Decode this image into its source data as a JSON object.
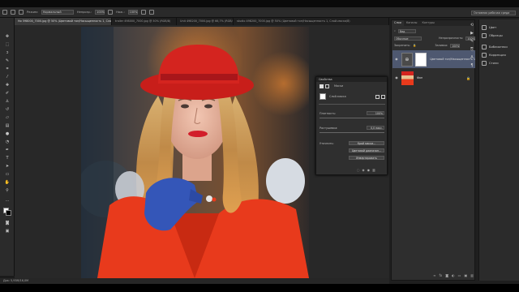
{
  "options_bar": {
    "mode_label": "Режим:",
    "mode_value": "Нормальный",
    "opacity_label": "Непрозр.:",
    "opacity_value": "100%",
    "flow_label": "Наж.:",
    "flow_value": "100%"
  },
  "workspace": "Основная рабочая среда",
  "tabs": [
    {
      "label": "Ни 598000_7000.jpg @ 50% (Цветовой тон/Насыщенность 1, Слой-маска/8)",
      "active": true
    },
    {
      "label": "trailer 498000_7000.jpg @ 50% (RGB/8)",
      "active": false
    },
    {
      "label": "Unit 498200_7000.jpg @ 66,7% (RGB/8)",
      "active": false
    },
    {
      "label": "studio 498200_7000.jpg @ 50% (Цветовой тон/Насыщенность 1, Слой-маска/8)",
      "active": false
    }
  ],
  "status": "Док: 5,93M/16,0M",
  "layers_panel": {
    "tabs": [
      "Слои",
      "Каналы",
      "Контуры"
    ],
    "kind_label": "Вид",
    "blend_mode": "Обычные",
    "opacity_label": "Непрозрачность:",
    "opacity_value": "100%",
    "lock_label": "Закрепить:",
    "fill_label": "Заливка:",
    "fill_value": "100%",
    "layers": [
      {
        "name": "Цветовой тон/Насыщенность 1",
        "selected": true
      },
      {
        "name": "Фон",
        "selected": false
      }
    ]
  },
  "properties": {
    "title": "Свойства",
    "section": "Маски",
    "mask_label": "Слой-маска",
    "density_label": "Плотность:",
    "density_value": "100%",
    "feather_label": "Растушевка:",
    "feather_value": "0,0 пикс.",
    "refine_label": "Уточнить:",
    "btn_edge": "Край маски...",
    "btn_color": "Цветовой диапазон...",
    "btn_invert": "Инвертировать"
  },
  "side_panel": {
    "items": [
      "Цвет",
      "Образцы",
      "Библиотеки",
      "Коррекция",
      "Стили"
    ]
  },
  "colors": {
    "hat": "#d4241f",
    "jacket": "#e83a1c",
    "glove": "#3456b8",
    "selected_layer": "#4e5870"
  }
}
